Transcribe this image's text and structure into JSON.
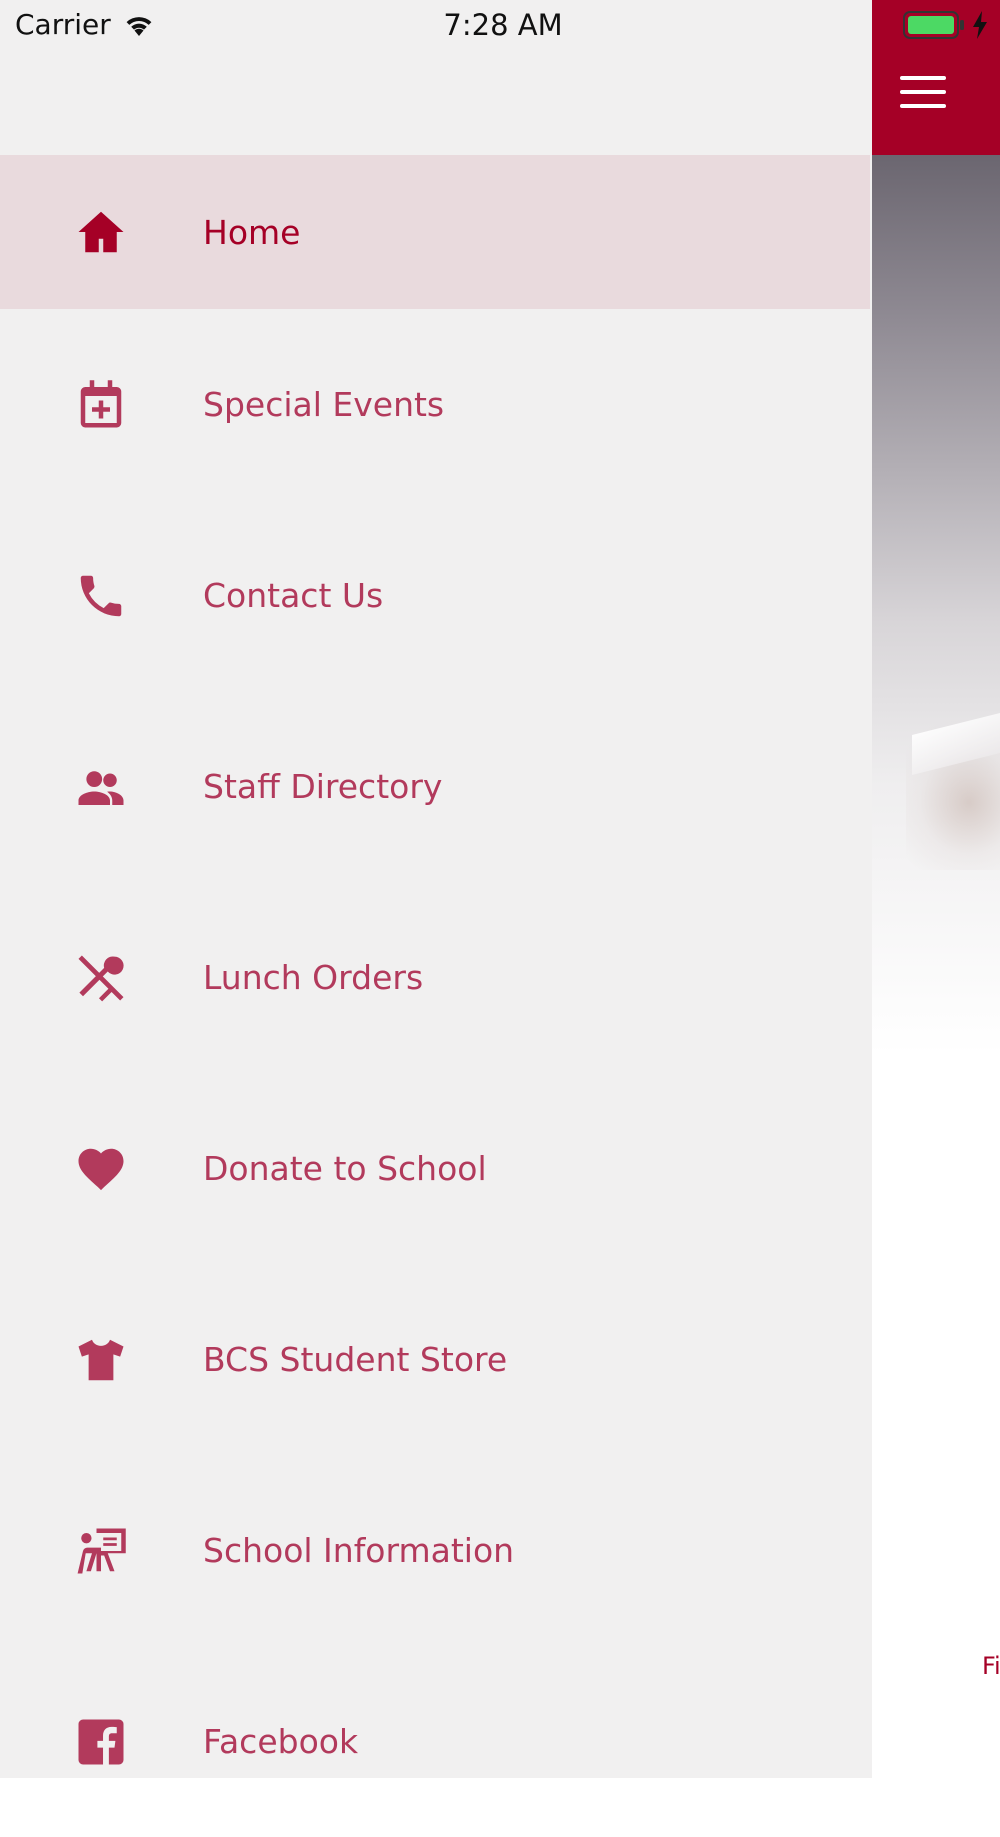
{
  "status_bar": {
    "carrier": "Carrier",
    "time": "7:28 AM"
  },
  "colors": {
    "brand": "#a50026",
    "menu_text": "#b23a5c",
    "active_row": "#e9dadd",
    "drawer_bg": "#f1f0f0"
  },
  "drawer": {
    "items": [
      {
        "label": "Home",
        "icon": "home-icon",
        "active": true
      },
      {
        "label": "Special Events",
        "icon": "calendar-plus-icon"
      },
      {
        "label": "Contact Us",
        "icon": "phone-icon"
      },
      {
        "label": "Staff Directory",
        "icon": "people-icon"
      },
      {
        "label": "Lunch Orders",
        "icon": "utensils-icon"
      },
      {
        "label": "Donate to School",
        "icon": "heart-icon"
      },
      {
        "label": "BCS Student Store",
        "icon": "tshirt-icon"
      },
      {
        "label": "School Information",
        "icon": "presentation-icon"
      },
      {
        "label": "Facebook",
        "icon": "facebook-icon"
      }
    ]
  },
  "main": {
    "footer_partial": "Fi"
  }
}
